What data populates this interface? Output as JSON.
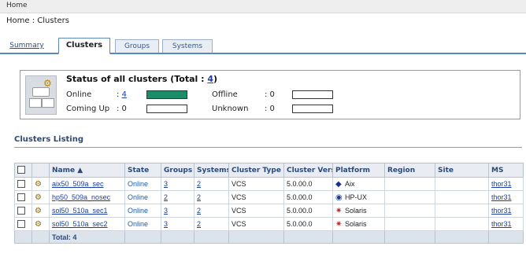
{
  "topbar": {
    "label": "Home"
  },
  "breadcrumb": "Home : Clusters",
  "tabs": [
    {
      "label": "Summary",
      "state": "link"
    },
    {
      "label": "Clusters",
      "state": "active"
    },
    {
      "label": "Groups",
      "state": "inactive"
    },
    {
      "label": "Systems",
      "state": "inactive"
    }
  ],
  "status": {
    "title_prefix": "Status of all clusters (Total : ",
    "total": "4",
    "title_suffix": ")",
    "online_label": "Online",
    "online_sep": ":",
    "online_value": "4",
    "online_fraction": 1.0,
    "offline_label": "Offline",
    "offline_value": ": 0",
    "offline_fraction": 0,
    "comingup_label": "Coming Up",
    "comingup_value": ": 0",
    "comingup_fraction": 0,
    "unknown_label": "Unknown",
    "unknown_value": ": 0",
    "unknown_fraction": 0,
    "online_color": "#1d8c68"
  },
  "listing": {
    "title": "Clusters Listing",
    "columns": [
      "",
      "",
      "Name ▲",
      "State",
      "Groups",
      "Systems",
      "Cluster Type",
      "Cluster Version",
      "Platform",
      "Region",
      "Site",
      "MS"
    ],
    "rows": [
      {
        "name": "aix50_509a_sec",
        "state": "Online",
        "groups": "3",
        "systems": "2",
        "type": "VCS",
        "version": "5.0.00.0",
        "platform": "Aix",
        "platform_icon": "aix-icon",
        "region": "",
        "site": "",
        "ms": "thor31"
      },
      {
        "name": "hp50_509a_nosec",
        "state": "Online",
        "groups": "2",
        "systems": "2",
        "type": "VCS",
        "version": "5.0.00.0",
        "platform": "HP-UX",
        "platform_icon": "hp-icon",
        "region": "",
        "site": "",
        "ms": "thor31"
      },
      {
        "name": "sol50_510a_sec1",
        "state": "Online",
        "groups": "3",
        "systems": "2",
        "type": "VCS",
        "version": "5.0.00.0",
        "platform": "Solaris",
        "platform_icon": "solaris-icon",
        "region": "",
        "site": "",
        "ms": "thor31"
      },
      {
        "name": "sol50_510a_sec2",
        "state": "Online",
        "groups": "3",
        "systems": "2",
        "type": "VCS",
        "version": "5.0.00.0",
        "platform": "Solaris",
        "platform_icon": "solaris-icon",
        "region": "",
        "site": "",
        "ms": "thor31"
      }
    ],
    "total_label": "Total: 4"
  }
}
